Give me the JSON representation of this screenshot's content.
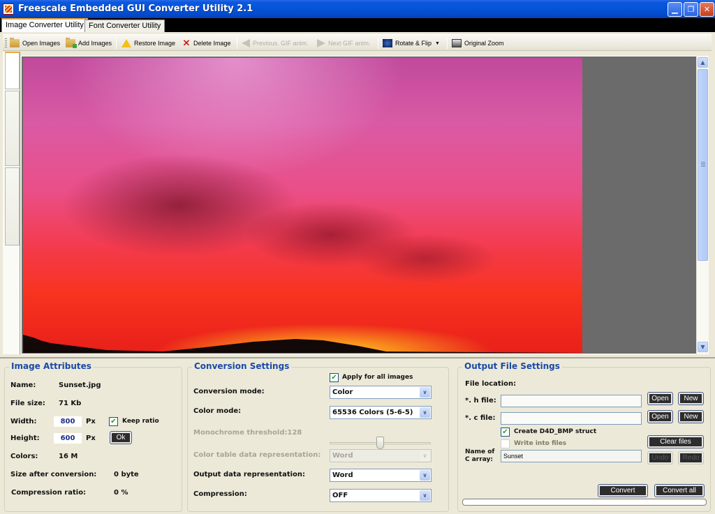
{
  "window": {
    "title": "Freescale Embedded GUI Converter Utility 2.1",
    "minimize": "▁",
    "maximize": "❐",
    "close": "✕"
  },
  "tabs": [
    {
      "label": "Image Converter Utility",
      "active": true
    },
    {
      "label": "Font Converter Utility",
      "active": false
    }
  ],
  "toolbar": {
    "open_images": "Open Images",
    "add_images": "Add Images",
    "restore_image": "Restore Image",
    "delete_image": "Delete Image",
    "prev_gif": "Previous. GIF anim.",
    "next_gif": "Next GIF anim.",
    "rotate_flip": "Rotate & Flip",
    "original_zoom": "Original Zoom",
    "dropdown_caret": "▼"
  },
  "scrollbar": {
    "up": "▲",
    "down": "▼"
  },
  "image_attributes": {
    "title": "Image Attributes",
    "name_label": "Name:",
    "name_value": "Sunset.jpg",
    "filesize_label": "File size:",
    "filesize_value": "71 Kb",
    "width_label": "Width:",
    "width_value": "800",
    "height_label": "Height:",
    "height_value": "600",
    "px_unit": "Px",
    "keep_ratio_label": "Keep ratio",
    "keep_ratio_checked": true,
    "ok_label": "Ok",
    "colors_label": "Colors:",
    "colors_value": "16 M",
    "size_after_label": "Size after conversion:",
    "size_after_value": "0 byte",
    "compression_ratio_label": "Compression ratio:",
    "compression_ratio_value": "0 %"
  },
  "conversion_settings": {
    "title": "Conversion Settings",
    "apply_all_label": "Apply for all images",
    "apply_all_checked": true,
    "conversion_mode_label": "Conversion mode:",
    "conversion_mode_value": "Color",
    "color_mode_label": "Color mode:",
    "color_mode_value": "65536 Colors (5-6-5)",
    "mono_threshold_label": "Monochrome threshold:128",
    "mono_threshold_value": 128,
    "mono_threshold_max": 255,
    "color_table_label": "Color table data representation:",
    "color_table_value": "Word",
    "output_data_label": "Output data representation:",
    "output_data_value": "Word",
    "compression_label": "Compression:",
    "compression_value": "OFF",
    "dropdown_glyph": "∨",
    "check_glyph": "✔"
  },
  "output_file_settings": {
    "title": "Output File Settings",
    "file_location_label": "File location:",
    "h_file_label": "*. h file:",
    "h_file_value": "",
    "c_file_label": "*. c file:",
    "c_file_value": "",
    "open_label": "Open",
    "new_label": "New",
    "create_struct_label": "Create D4D_BMP struct",
    "create_struct_checked": true,
    "write_files_label": "Write into files",
    "write_files_checked": false,
    "clear_files_label": "Clear files",
    "name_array_label_1": "Name of",
    "name_array_label_2": "C array:",
    "name_array_value": "Sunset",
    "undo_label": "Undo",
    "redo_label": "Redo",
    "convert_label": "Convert",
    "convert_all_label": "Convert all",
    "progress": 0
  }
}
